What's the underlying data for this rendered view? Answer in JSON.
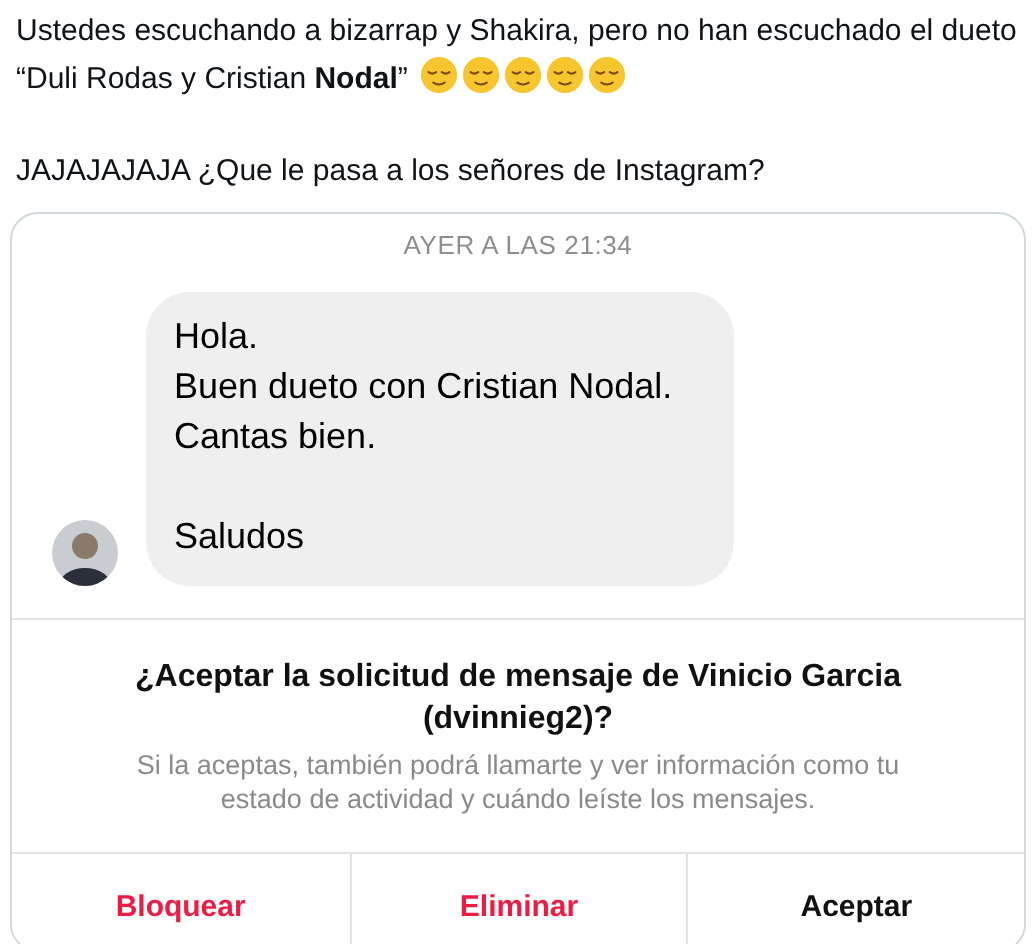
{
  "tweet": {
    "lines": [
      "Ustedes escuchando a bizarrap y Shakira, pero no han escuchado el dueto",
      "“Duli Rodas y Cristian **Nodal**”"
    ],
    "emojis": [
      {
        "kind": "relieved-face"
      },
      {
        "kind": "relieved-face"
      },
      {
        "kind": "relieved-face"
      },
      {
        "kind": "relieved-face"
      },
      {
        "kind": "relieved-face"
      }
    ],
    "text_2": "JAJAJAJAJA ¿Que le pasa a los señores de Instagram?"
  },
  "chat": {
    "timestamp": "AYER A LAS 21:34",
    "message": {
      "paragraphs": [
        [
          "Hola.",
          "Buen dueto con Cristian Nodal.",
          "Cantas bien."
        ],
        [
          "Saludos"
        ]
      ]
    }
  },
  "request": {
    "title": "¿Aceptar la solicitud de mensaje de Vinicio Garcia (dvinnieg2)?",
    "description": "Si la aceptas, también podrá llamarte y ver información como tu estado de actividad y cuándo leíste los mensajes.",
    "buttons": [
      {
        "label": "Bloquear",
        "kind": "destructive"
      },
      {
        "label": "Eliminar",
        "kind": "destructive"
      },
      {
        "label": "Aceptar",
        "kind": "default"
      }
    ]
  }
}
